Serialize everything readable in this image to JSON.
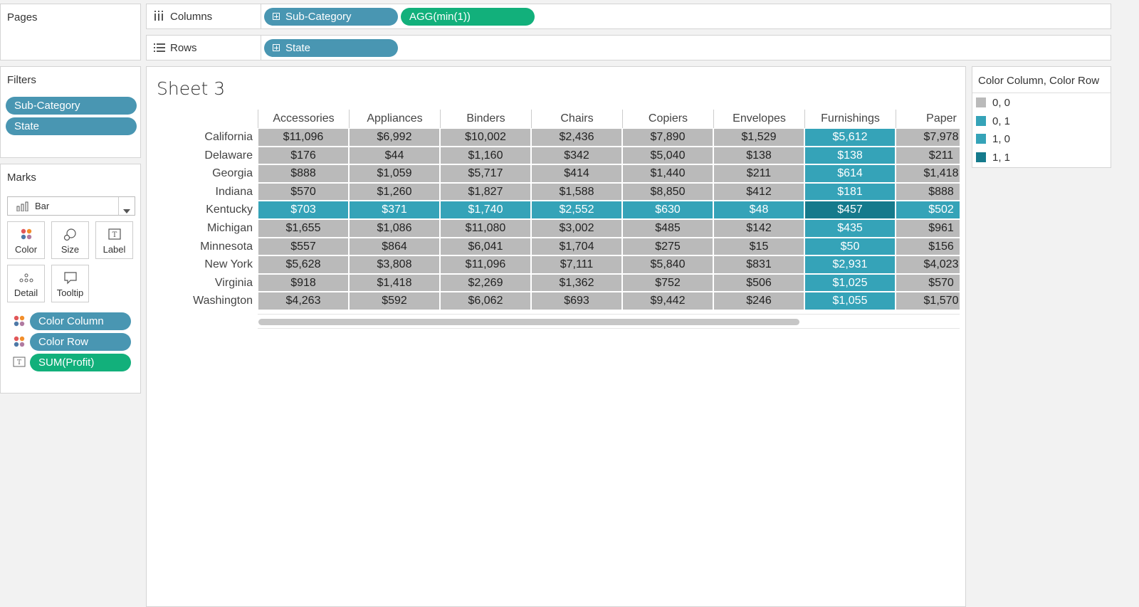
{
  "shelves": {
    "pages_label": "Pages",
    "columns_label": "Columns",
    "rows_label": "Rows",
    "columns_pills": [
      "Sub-Category",
      "AGG(min(1))"
    ],
    "rows_pills": [
      "State"
    ]
  },
  "filters": {
    "title": "Filters",
    "items": [
      "Sub-Category",
      "State"
    ]
  },
  "marks": {
    "title": "Marks",
    "mark_type": "Bar",
    "buttons": [
      "Color",
      "Size",
      "Label",
      "Detail",
      "Tooltip"
    ],
    "fields": [
      "Color Column",
      "Color Row",
      "SUM(Profit)"
    ]
  },
  "sheet": {
    "title": "Sheet 3"
  },
  "legend": {
    "title": "Color Column, Color Row",
    "items": [
      {
        "label": "0, 0",
        "color": "#bababa"
      },
      {
        "label": "0, 1",
        "color": "#35a3b8"
      },
      {
        "label": "1, 0",
        "color": "#35a3b8"
      },
      {
        "label": "1, 1",
        "color": "#157a8c"
      }
    ]
  },
  "table": {
    "columns": [
      "Accessories",
      "Appliances",
      "Binders",
      "Chairs",
      "Copiers",
      "Envelopes",
      "Furnishings",
      "Paper"
    ],
    "rows": [
      "California",
      "Delaware",
      "Georgia",
      "Indiana",
      "Kentucky",
      "Michigan",
      "Minnesota",
      "New York",
      "Virginia",
      "Washington"
    ],
    "values": [
      [
        "$11,096",
        "$6,992",
        "$10,002",
        "$2,436",
        "$7,890",
        "$1,529",
        "$5,612",
        "$7,978"
      ],
      [
        "$176",
        "$44",
        "$1,160",
        "$342",
        "$5,040",
        "$138",
        "$138",
        "$211"
      ],
      [
        "$888",
        "$1,059",
        "$5,717",
        "$414",
        "$1,440",
        "$211",
        "$614",
        "$1,418"
      ],
      [
        "$570",
        "$1,260",
        "$1,827",
        "$1,588",
        "$8,850",
        "$412",
        "$181",
        "$888"
      ],
      [
        "$703",
        "$371",
        "$1,740",
        "$2,552",
        "$630",
        "$48",
        "$457",
        "$502"
      ],
      [
        "$1,655",
        "$1,086",
        "$11,080",
        "$3,002",
        "$485",
        "$142",
        "$435",
        "$961"
      ],
      [
        "$557",
        "$864",
        "$6,041",
        "$1,704",
        "$275",
        "$15",
        "$50",
        "$156"
      ],
      [
        "$5,628",
        "$3,808",
        "$11,096",
        "$7,111",
        "$5,840",
        "$831",
        "$2,931",
        "$4,023"
      ],
      [
        "$918",
        "$1,418",
        "$2,269",
        "$1,362",
        "$752",
        "$506",
        "$1,025",
        "$570"
      ],
      [
        "$4,263",
        "$592",
        "$6,062",
        "$693",
        "$9,442",
        "$246",
        "$1,055",
        "$1,570"
      ]
    ],
    "highlight_row": "Kentucky",
    "highlight_column": "Furnishings"
  }
}
